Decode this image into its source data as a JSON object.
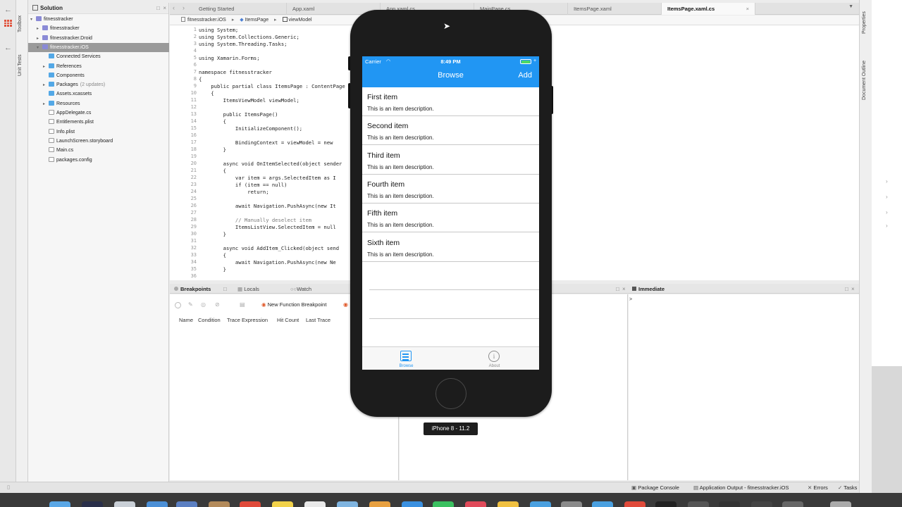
{
  "left_strip": {
    "vtabs": [
      "Toolbox",
      "Unit Tests"
    ]
  },
  "solution": {
    "title": "Solution",
    "items": [
      {
        "label": "fitnesstracker",
        "indent": 0,
        "type": "proj",
        "twist": "▾"
      },
      {
        "label": "fitnesstracker",
        "indent": 1,
        "type": "proj",
        "twist": "▸"
      },
      {
        "label": "fitnesstracker.Droid",
        "indent": 1,
        "type": "proj",
        "twist": "▸"
      },
      {
        "label": "fitnesstracker.iOS",
        "indent": 1,
        "type": "proj",
        "twist": "▾",
        "selected": true
      },
      {
        "label": "Connected Services",
        "indent": 2,
        "type": "folder",
        "twist": ""
      },
      {
        "label": "References",
        "indent": 2,
        "type": "folder",
        "twist": "▸"
      },
      {
        "label": "Components",
        "indent": 2,
        "type": "folder",
        "twist": ""
      },
      {
        "label": "Packages",
        "note": "(2 updates)",
        "indent": 2,
        "type": "folder",
        "twist": "▸"
      },
      {
        "label": "Assets.xcassets",
        "indent": 2,
        "type": "folder",
        "twist": ""
      },
      {
        "label": "Resources",
        "indent": 2,
        "type": "folder",
        "twist": "▸"
      },
      {
        "label": "AppDelegate.cs",
        "indent": 2,
        "type": "file",
        "twist": ""
      },
      {
        "label": "Entitlements.plist",
        "indent": 2,
        "type": "file",
        "twist": ""
      },
      {
        "label": "Info.plist",
        "indent": 2,
        "type": "file",
        "twist": ""
      },
      {
        "label": "LaunchScreen.storyboard",
        "indent": 2,
        "type": "file",
        "twist": ""
      },
      {
        "label": "Main.cs",
        "indent": 2,
        "type": "file",
        "twist": ""
      },
      {
        "label": "packages.config",
        "indent": 2,
        "type": "file",
        "twist": ""
      }
    ]
  },
  "tabs": [
    {
      "label": "Getting Started",
      "active": false
    },
    {
      "label": "App.xaml",
      "active": false
    },
    {
      "label": "App.xaml.cs",
      "active": false
    },
    {
      "label": "MainPage.cs",
      "active": false
    },
    {
      "label": "ItemsPage.xaml",
      "active": false
    },
    {
      "label": "ItemsPage.xaml.cs",
      "active": true
    }
  ],
  "breadcrumb": [
    "fitnesstracker.iOS",
    "ItemsPage",
    "viewModel"
  ],
  "code_lines": [
    {
      "n": "1",
      "t": "using System;"
    },
    {
      "n": "2",
      "t": "using System.Collections.Generic;"
    },
    {
      "n": "3",
      "t": "using System.Threading.Tasks;"
    },
    {
      "n": "4",
      "t": ""
    },
    {
      "n": "5",
      "t": "using Xamarin.Forms;"
    },
    {
      "n": "6",
      "t": ""
    },
    {
      "n": "7",
      "t": "namespace fitnesstracker"
    },
    {
      "n": "8",
      "t": "{"
    },
    {
      "n": "9",
      "t": "    public partial class ItemsPage : ContentPage"
    },
    {
      "n": "10",
      "t": "    {"
    },
    {
      "n": "11",
      "t": "        ItemsViewModel viewModel;"
    },
    {
      "n": "12",
      "t": ""
    },
    {
      "n": "13",
      "t": "        public ItemsPage()"
    },
    {
      "n": "14",
      "t": "        {"
    },
    {
      "n": "15",
      "t": "            InitializeComponent();"
    },
    {
      "n": "16",
      "t": ""
    },
    {
      "n": "17",
      "t": "            BindingContext = viewModel = new"
    },
    {
      "n": "18",
      "t": "        }"
    },
    {
      "n": "19",
      "t": ""
    },
    {
      "n": "20",
      "t": "        async void OnItemSelected(object sender"
    },
    {
      "n": "21",
      "t": "        {"
    },
    {
      "n": "22",
      "t": "            var item = args.SelectedItem as I"
    },
    {
      "n": "23",
      "t": "            if (item == null)"
    },
    {
      "n": "24",
      "t": "                return;"
    },
    {
      "n": "25",
      "t": ""
    },
    {
      "n": "26",
      "t": "            await Navigation.PushAsync(new It"
    },
    {
      "n": "27",
      "t": ""
    },
    {
      "n": "28",
      "t": "            // Manually deselect item"
    },
    {
      "n": "29",
      "t": "            ItemsListView.SelectedItem = null"
    },
    {
      "n": "30",
      "t": "        }"
    },
    {
      "n": "31",
      "t": ""
    },
    {
      "n": "32",
      "t": "        async void AddItem_Clicked(object send"
    },
    {
      "n": "33",
      "t": "        {"
    },
    {
      "n": "34",
      "t": "            await Navigation.PushAsync(new Ne"
    },
    {
      "n": "35",
      "t": "        }"
    },
    {
      "n": "36",
      "t": ""
    }
  ],
  "pads": {
    "tabs": [
      "Breakpoints",
      "Locals",
      "Watch"
    ],
    "new_function_breakpoint": "New Function Breakpoint",
    "columns": [
      "Name",
      "Condition",
      "Trace Expression",
      "Hit Count",
      "Last Trace"
    ],
    "immediate_title": "Immediate",
    "immediate_prompt": ">"
  },
  "statusbar": {
    "package_console": "Package Console",
    "app_output": "Application Output - fitnesstracker.iOS",
    "errors": "Errors",
    "tasks": "Tasks"
  },
  "right_strip": {
    "vtabs": [
      "Properties",
      "Document Outline"
    ]
  },
  "phone": {
    "carrier": "Carrier",
    "time": "8:49 PM",
    "nav_title": "Browse",
    "add_label": "Add",
    "items": [
      {
        "title": "First item",
        "desc": "This is an item description."
      },
      {
        "title": "Second item",
        "desc": "This is an item description."
      },
      {
        "title": "Third item",
        "desc": "This is an item description."
      },
      {
        "title": "Fourth item",
        "desc": "This is an item description."
      },
      {
        "title": "Fifth item",
        "desc": "This is an item description."
      },
      {
        "title": "Sixth item",
        "desc": "This is an item description."
      }
    ],
    "tab_browse": "Browse",
    "tab_about": "About",
    "device_label": "iPhone 8 - 11.2",
    "accent_color": "#2196f3"
  }
}
